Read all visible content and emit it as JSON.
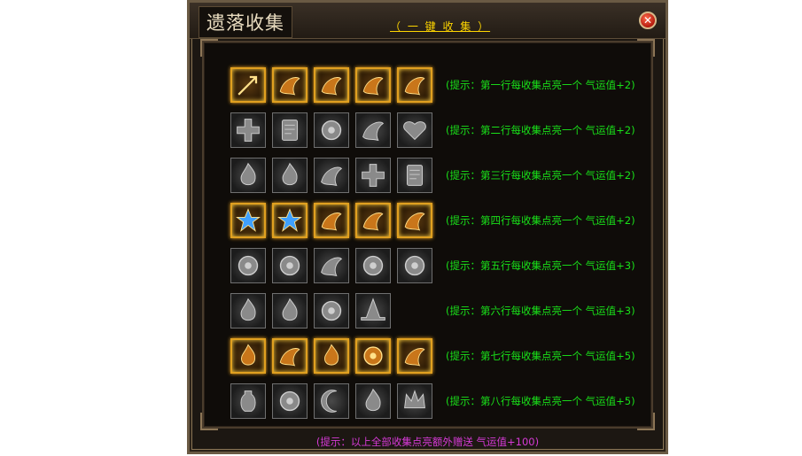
{
  "window": {
    "title": "遗落收集",
    "collect_all": "（ 一 键 收 集 ）",
    "close_symbol": "✕"
  },
  "rows": [
    {
      "lit": true,
      "icons": [
        "arrow-icon",
        "swirl-gem-icon",
        "winged-armor-icon",
        "fist-icon",
        "dragon-horn-icon"
      ],
      "hint": "(提示：第一行每收集点亮一个 气运值+2)"
    },
    {
      "lit": false,
      "icons": [
        "cross-shield-icon",
        "talisman-icon",
        "dragon-eye-icon",
        "coiled-dragon-icon",
        "heart-icon"
      ],
      "hint": "(提示：第二行每收集点亮一个 气运值+2)"
    },
    {
      "lit": false,
      "icons": [
        "flame-icon",
        "flame-icon",
        "smoke-icon",
        "skull-crossbones-icon",
        "scroll-icon"
      ],
      "hint": "(提示：第三行每收集点亮一个 气运值+2)"
    },
    {
      "lit": true,
      "icons": [
        "blue-star-icon",
        "blue-star-icon",
        "purple-wing-icon",
        "orange-gem-icon",
        "blue-feather-icon"
      ],
      "hint": "(提示：第四行每收集点亮一个 气运值+2)"
    },
    {
      "lit": false,
      "icons": [
        "turtle-shell-icon",
        "turtle-shell-icon",
        "claw-icon",
        "sun-disc-icon",
        "dark-orb-icon"
      ],
      "hint": "(提示：第五行每收集点亮一个 气运值+3)"
    },
    {
      "lit": false,
      "icons": [
        "flame-icon",
        "lotus-flame-icon",
        "spirit-orb-icon",
        "witch-hat-icon"
      ],
      "hint": "(提示：第六行每收集点亮一个 气运值+3)"
    },
    {
      "lit": true,
      "icons": [
        "fire-burst-icon",
        "ice-wing-icon",
        "fire-claw-icon",
        "purple-eye-icon",
        "sun-medal-icon"
      ],
      "hint": "(提示：第七行每收集点亮一个 气运值+5)"
    },
    {
      "lit": false,
      "icons": [
        "vase-icon",
        "spiral-icon",
        "crescent-icon",
        "flame-icon",
        "crown-icon"
      ],
      "hint": "(提示：第八行每收集点亮一个 气运值+5)"
    }
  ],
  "footer": "(提示：以上全部收集点亮额外赠送 气运值+100)",
  "colors": {
    "hint": "#19e019",
    "footer": "#d63ad6",
    "collect_all": "#ffd600"
  }
}
